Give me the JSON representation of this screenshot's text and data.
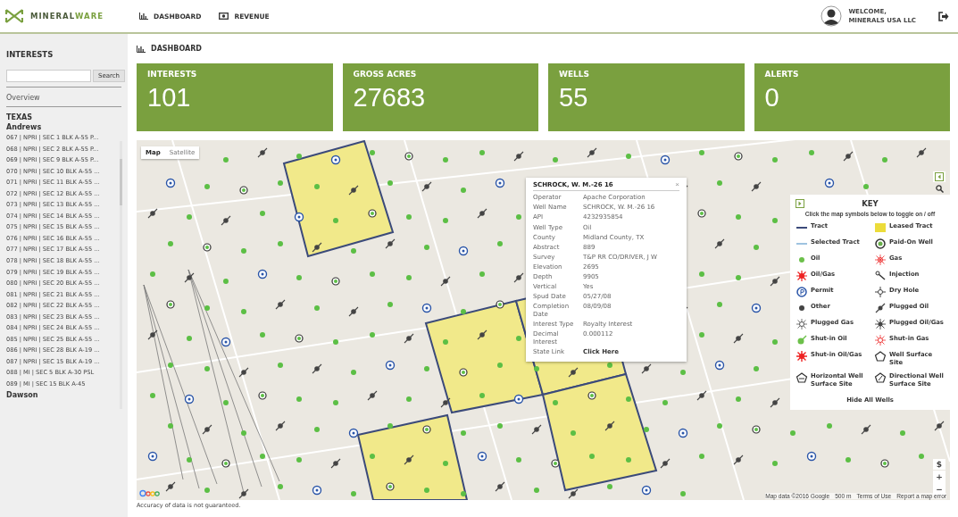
{
  "header": {
    "logo": "MINERAL**WARE**",
    "nav": [
      {
        "label": "DASHBOARD",
        "kind": "chart"
      },
      {
        "label": "REVENUE",
        "kind": "money"
      }
    ],
    "user": {
      "greeting": "WELCOME,",
      "name": "MINERALS USA LLC"
    }
  },
  "sidebar": {
    "title": "INTERESTS",
    "search_button": "Search",
    "overview": "Overview",
    "state": "TEXAS",
    "counties": [
      {
        "name": "Andrews",
        "items": [
          "067 | NPRI | SEC 1 BLK A-55 P...",
          "068 | NPRI | SEC 2 BLK A-55 P...",
          "069 | NPRI | SEC 9 BLK A-55 P...",
          "070 | NPRI | SEC 10 BLK A-55 ...",
          "071 | NPRI | SEC 11 BLK A-55 ...",
          "072 | NPRI | SEC 12 BLK A-55 ...",
          "073 | NPRI | SEC 13 BLK A-55 ...",
          "074 | NPRI | SEC 14 BLK A-55 ...",
          "075 | NPRI | SEC 15 BLK A-55 ...",
          "076 | NPRI | SEC 16 BLK A-55 ...",
          "077 | NPRI | SEC 17 BLK A-55 ...",
          "078 | NPRI | SEC 18 BLK A-55 ...",
          "079 | NPRI | SEC 19 BLK A-55 ...",
          "080 | NPRI | SEC 20 BLK A-55 ...",
          "081 | NPRI | SEC 21 BLK A-55 ...",
          "082 | NPRI | SEC 22 BLK A-55 ...",
          "083 | NPRI | SEC 23 BLK A-55 ...",
          "084 | NPRI | SEC 24 BLK A-55 ...",
          "085 | NPRI | SEC 25 BLK A-55 ...",
          "086 | NPRI | SEC 28 BLK A-19 ...",
          "087 | NPRI | SEC 15 BLK A-19 ...",
          "088 | MI | SEC 5 BLK A-30 PSL",
          "089 | MI | SEC 15 BLK A-45"
        ]
      },
      {
        "name": "Dawson"
      }
    ]
  },
  "page_title": "DASHBOARD",
  "stats": [
    {
      "label": "INTERESTS",
      "value": "101"
    },
    {
      "label": "GROSS ACRES",
      "value": "27683"
    },
    {
      "label": "WELLS",
      "value": "55"
    },
    {
      "label": "ALERTS",
      "value": "0"
    }
  ],
  "map": {
    "type_toggle": [
      {
        "label": "Map",
        "selected": true
      },
      {
        "label": "Satellite",
        "selected": false
      }
    ],
    "popup": {
      "title": "SCHROCK, W. M.-26 16",
      "close": "×",
      "fields": [
        {
          "label": "Operator",
          "value": "Apache Corporation"
        },
        {
          "label": "Well Name",
          "value": "SCHROCK, W. M.-26 16"
        },
        {
          "label": "API",
          "value": "4232935854"
        },
        {
          "label": "Well Type",
          "value": "Oil"
        },
        {
          "label": "County",
          "value": "Midland County, TX"
        },
        {
          "label": "Abstract",
          "value": "889"
        },
        {
          "label": "Survey",
          "value": "T&P RR CO/DRIVER, J W"
        },
        {
          "label": "Elevation",
          "value": "2695"
        },
        {
          "label": "Depth",
          "value": "9905"
        },
        {
          "label": "Vertical",
          "value": "Yes"
        },
        {
          "label": "Spud Date",
          "value": "05/27/08"
        },
        {
          "label": "Completion Date",
          "value": "08/09/08"
        },
        {
          "label": "Interest Type",
          "value": "Royalty Interest"
        },
        {
          "label": "Decimal Interest",
          "value": "0.000112"
        },
        {
          "label": "State Link",
          "value": "Click Here",
          "kind": "link"
        }
      ]
    },
    "key": {
      "title": "KEY",
      "hint": "Click the map symbols below to toggle on / off",
      "items": [
        {
          "label": "Tract",
          "kind": "tract"
        },
        {
          "label": "Leased Tract",
          "kind": "leased-tract"
        },
        {
          "label": "Selected Tract",
          "kind": "selected-tract"
        },
        {
          "label": "Paid-On Well",
          "kind": "paid-on"
        },
        {
          "label": "Oil",
          "kind": "oil"
        },
        {
          "label": "Gas",
          "kind": "gas"
        },
        {
          "label": "Oil/Gas",
          "kind": "oil-gas"
        },
        {
          "label": "Injection",
          "kind": "injection"
        },
        {
          "label": "Permit",
          "kind": "permit"
        },
        {
          "label": "Dry Hole",
          "kind": "dry-hole"
        },
        {
          "label": "Other",
          "kind": "other"
        },
        {
          "label": "Plugged Oil",
          "kind": "plugged-oil"
        },
        {
          "label": "Plugged Gas",
          "kind": "plugged-gas"
        },
        {
          "label": "Plugged Oil/Gas",
          "kind": "plugged-oil-gas"
        },
        {
          "label": "Shut-in Oil",
          "kind": "shut-in-oil"
        },
        {
          "label": "Shut-in Gas",
          "kind": "shut-in-gas"
        },
        {
          "label": "Shut-in Oil/Gas",
          "kind": "shut-in-oil-gas"
        },
        {
          "label": "Well Surface Site",
          "kind": "well-site"
        },
        {
          "label": "Horizontal Well Surface Site",
          "kind": "horizontal-site"
        },
        {
          "label": "Directional Well Surface Site",
          "kind": "directional-site"
        }
      ],
      "hide_button": "Hide All Wells"
    },
    "zoom_in": "+",
    "zoom_out": "−",
    "currency": "$",
    "attribution": {
      "data": "Map data ©2016 Google",
      "scale": "500 m",
      "terms": "Terms of Use",
      "report": "Report a map error"
    }
  },
  "disclaimer": "Accuracy of data is not guaranteed."
}
